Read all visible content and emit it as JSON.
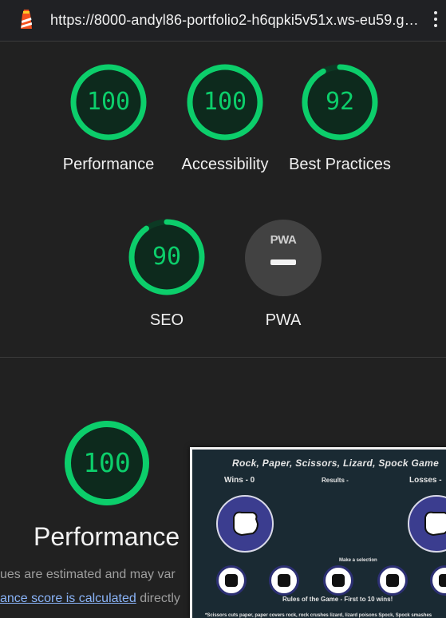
{
  "browser": {
    "url": "https://8000-andyl86-portfolio2-h6qpki5v51x.ws-eu59.g…"
  },
  "scores": [
    {
      "label": "Performance",
      "score": "100",
      "fraction": 1.0
    },
    {
      "label": "Accessibility",
      "score": "100",
      "fraction": 1.0
    },
    {
      "label": "Best Practices",
      "score": "92",
      "fraction": 0.92
    },
    {
      "label": "SEO",
      "score": "90",
      "fraction": 0.9
    }
  ],
  "pwa": {
    "badge_text": "PWA",
    "label": "PWA"
  },
  "detail": {
    "score": "100",
    "fraction": 1.0,
    "title": "Performance",
    "note_line1": "ues are estimated and may var",
    "note_link": "ance score is calculated",
    "note_after_link": " directly"
  },
  "colors": {
    "pass": "#0cce6b",
    "pass_track": "#0c3a24",
    "background": "#212121"
  },
  "thumbnail": {
    "title": "Rock, Paper, Scissors, Lizard, Spock Game",
    "wins": "Wins - 0",
    "results": "Results -",
    "losses": "Losses -",
    "make_selection": "Make a selection",
    "rules": "Rules of the Game - First to 10 wins!",
    "description": "*Scissors cuts paper, paper covers rock, rock crushes lizard, lizard poisons Spock, Spock smashes"
  }
}
